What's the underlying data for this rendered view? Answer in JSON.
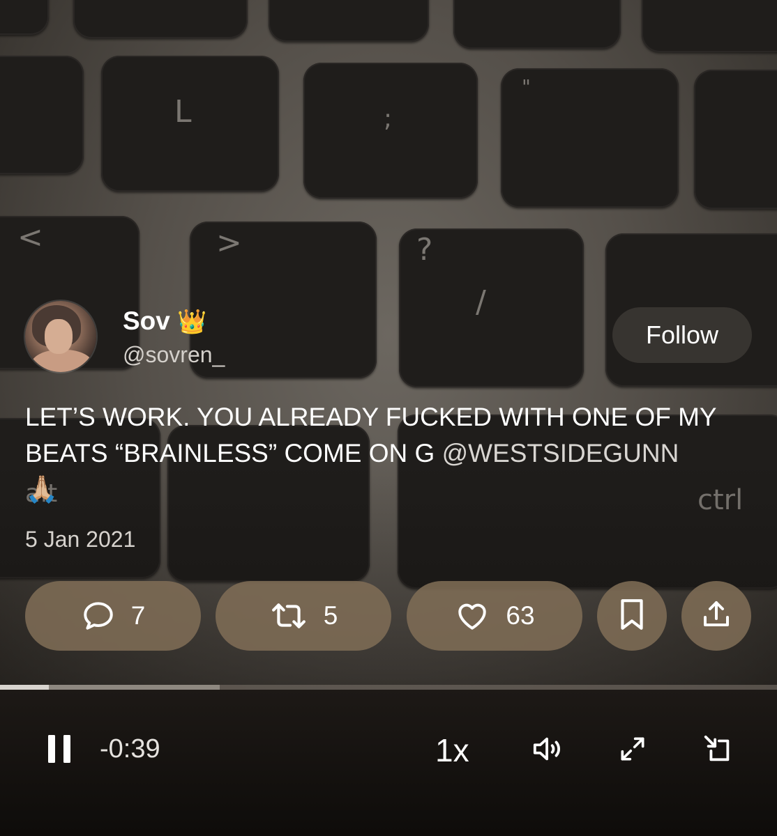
{
  "background": {
    "key_glyphs": [
      "L",
      ";",
      "\"",
      "<",
      ">",
      "?",
      "/",
      "alt",
      "ctrl"
    ]
  },
  "author": {
    "name": "Sov",
    "badge_emoji": "👑",
    "handle": "@sovren_",
    "follow_label": "Follow"
  },
  "tweet": {
    "text": "LET’S WORK. YOU ALREADY FUCKED WITH ONE OF MY BEATS “BRAINLESS” COME ON G ",
    "mention": "@WESTSIDEGUNN",
    "emoji": "🙏🏼",
    "date": "5 Jan 2021"
  },
  "actions": {
    "replies": "7",
    "retweets": "5",
    "likes": "63",
    "icons": [
      "reply-icon",
      "retweet-icon",
      "like-icon",
      "bookmark-icon",
      "share-icon"
    ]
  },
  "player": {
    "played_fraction": 0.063,
    "buffered_fraction": 0.283,
    "time_remaining": "-0:39",
    "speed": "1x",
    "icons": [
      "pause-icon",
      "volume-icon",
      "fullscreen-icon",
      "pip-icon"
    ]
  },
  "colors": {
    "pill": "#7e6c55",
    "follow_bg": "#3c3834",
    "text": "#ffffff"
  }
}
